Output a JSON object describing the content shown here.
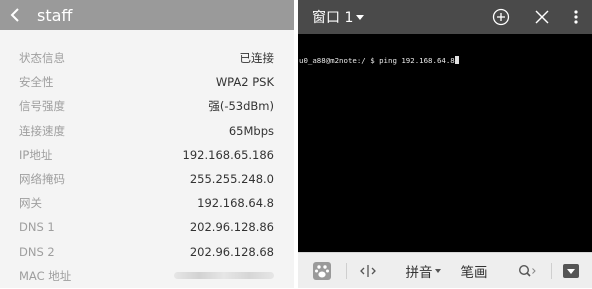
{
  "wifi_details": {
    "header": {
      "title": "staff",
      "back_icon": "chevron-left-icon"
    },
    "rows": [
      {
        "label": "状态信息",
        "value": "已连接"
      },
      {
        "label": "安全性",
        "value": "WPA2 PSK"
      },
      {
        "label": "信号强度",
        "value": "强(-53dBm)"
      },
      {
        "label": "连接速度",
        "value": "65Mbps"
      },
      {
        "label": "IP地址",
        "value": "192.168.65.186"
      },
      {
        "label": "网络掩码",
        "value": "255.255.248.0"
      },
      {
        "label": "网关",
        "value": "192.168.64.8"
      },
      {
        "label": "DNS 1",
        "value": "202.96.128.86"
      },
      {
        "label": "DNS 2",
        "value": "202.96.128.68"
      },
      {
        "label": "MAC 地址",
        "value": ""
      }
    ]
  },
  "terminal": {
    "toolbar": {
      "window_title": "窗口 1",
      "add_icon": "plus-circle-icon",
      "close_icon": "close-icon",
      "menu_icon": "more-vertical-icon"
    },
    "lines": [
      {
        "prompt": "u0_a88@m2note:/ $ ",
        "command": "ping 192.168.64.8"
      }
    ]
  },
  "ime_bar": {
    "logo_icon": "baidu-paw-icon",
    "cursor_move_icon": "cursor-move-icon",
    "pinyin_label": "拼音",
    "stroke_label": "笔画",
    "search_icon": "search-icon",
    "hide_keyboard_icon": "keyboard-hide-icon"
  }
}
